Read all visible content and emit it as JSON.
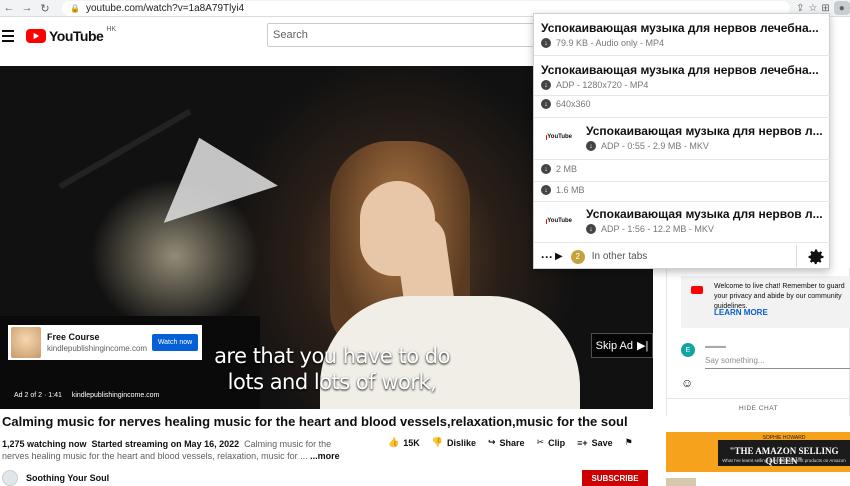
{
  "browser": {
    "url": "youtube.com/watch?v=1a8A79Tlyi4"
  },
  "header": {
    "logo_text": "YouTube",
    "country": "HK",
    "search_placeholder": "Search"
  },
  "video": {
    "ad_card": {
      "title": "Free Course",
      "url": "kindlepublishingincome.com",
      "cta": "Watch now"
    },
    "caption_line1": "are that you have to do",
    "caption_line2": "lots and lots of work,",
    "skip_ad": "Skip Ad",
    "ad_counter": "Ad 2 of 2 · 1:41",
    "ad_site": "kindlepublishingincome.com"
  },
  "info": {
    "title": "Calming music for nerves healing music for the heart and blood vessels,relaxation,music for the soul",
    "watching": "1,275 watching now",
    "started": "Started streaming on May 16, 2022",
    "desc_line1": "Calming music for the",
    "desc_line2": "nerves healing music for the heart and blood vessels, relaxation, music for ...",
    "more": "...more",
    "likes": "15K",
    "dislike": "Dislike",
    "share": "Share",
    "clip": "Clip",
    "save": "Save",
    "channel": "Soothing Your Soul",
    "subscribe": "SUBSCRIBE"
  },
  "chat": {
    "welcome": "Welcome to live chat! Remember to guard your privacy and abide by our community guidelines.",
    "learn_more": "LEARN MORE",
    "avatar_letter": "E",
    "placeholder": "Say something...",
    "hide_chat": "HIDE CHAT"
  },
  "side_ad": {
    "author": "SOPHIE HOWARD",
    "headline": "\"THE AMAZON SELLING QUEEN\"",
    "sub": "What I've learnt selling over 500 different products on Amazon"
  },
  "extension": {
    "items": [
      {
        "title": "Успокаивающая музыка для нервов  лечебна...",
        "sub": "79.9 KB - Audio only - MP4"
      },
      {
        "title": "Успокаивающая музыка для нервов  лечебна...",
        "sub": "ADP - 1280x720 - MP4"
      },
      {
        "sub": "640x360"
      },
      {
        "title": "Успокаивающая музыка для нервов  л...",
        "sub": "ADP - 0:55 - 2.9 MB - MKV"
      },
      {
        "sub": "2 MB"
      },
      {
        "sub": "1.6 MB"
      },
      {
        "title": "Успокаивающая музыка для нервов  л...",
        "sub": "ADP - 1:56 - 12.2 MB - MKV"
      }
    ],
    "other_tabs_count": "2",
    "other_tabs_label": "In other tabs",
    "thumb_logo": "YouTube"
  }
}
